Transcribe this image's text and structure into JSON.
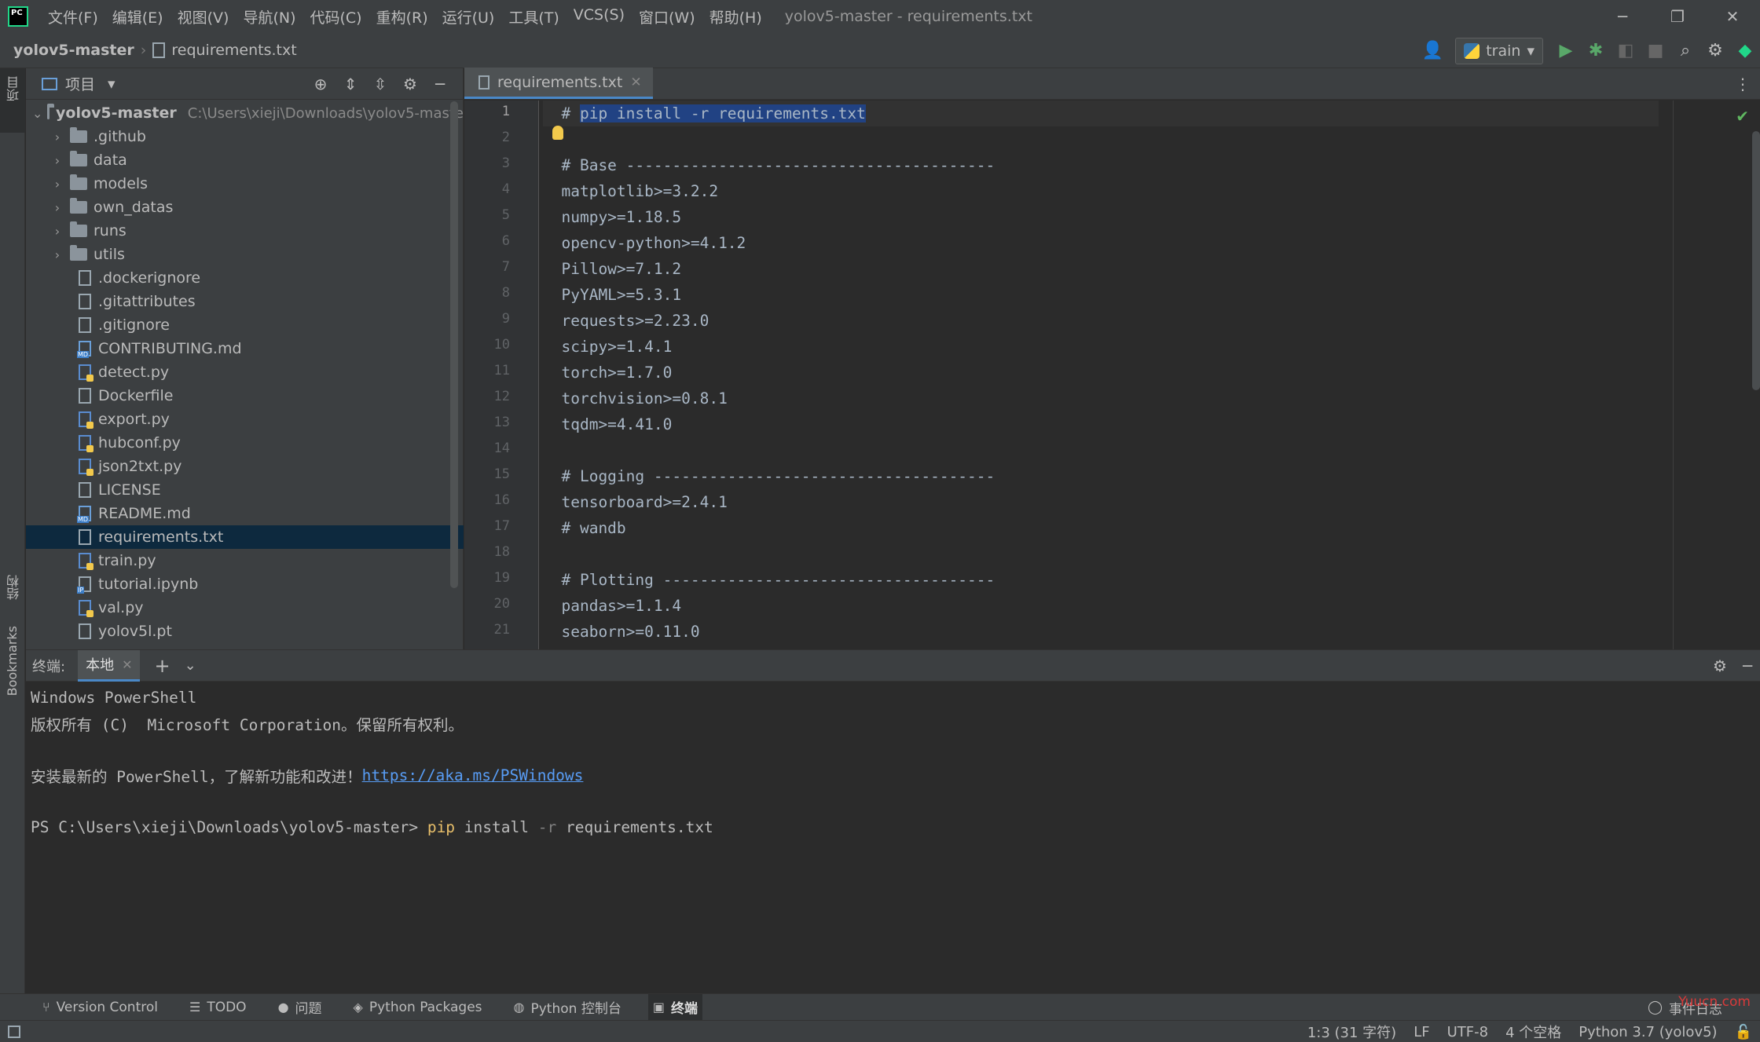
{
  "app": {
    "logo_text": "PC",
    "menu": [
      "文件(F)",
      "编辑(E)",
      "视图(V)",
      "导航(N)",
      "代码(C)",
      "重构(R)",
      "运行(U)",
      "工具(T)",
      "VCS(S)",
      "窗口(W)",
      "帮助(H)"
    ],
    "window_title": "yolov5-master - requirements.txt"
  },
  "breadcrumb": {
    "project": "yolov5-master",
    "file": "requirements.txt"
  },
  "run_config": {
    "label": "train"
  },
  "left_strip": {
    "project": "项目",
    "structure": "结构",
    "bookmarks": "Bookmarks"
  },
  "project_panel": {
    "title": "项目",
    "tree": [
      {
        "name": "yolov5-master",
        "type": "root",
        "hint": "C:\\Users\\xieji\\Downloads\\yolov5-maste"
      },
      {
        "name": ".github",
        "type": "folder"
      },
      {
        "name": "data",
        "type": "folder"
      },
      {
        "name": "models",
        "type": "folder"
      },
      {
        "name": "own_datas",
        "type": "folder"
      },
      {
        "name": "runs",
        "type": "folder"
      },
      {
        "name": "utils",
        "type": "folder"
      },
      {
        "name": ".dockerignore",
        "type": "file"
      },
      {
        "name": ".gitattributes",
        "type": "file"
      },
      {
        "name": ".gitignore",
        "type": "file"
      },
      {
        "name": "CONTRIBUTING.md",
        "type": "md"
      },
      {
        "name": "detect.py",
        "type": "py"
      },
      {
        "name": "Dockerfile",
        "type": "file"
      },
      {
        "name": "export.py",
        "type": "py"
      },
      {
        "name": "hubconf.py",
        "type": "py"
      },
      {
        "name": "json2txt.py",
        "type": "py"
      },
      {
        "name": "LICENSE",
        "type": "file"
      },
      {
        "name": "README.md",
        "type": "md"
      },
      {
        "name": "requirements.txt",
        "type": "file",
        "selected": true
      },
      {
        "name": "train.py",
        "type": "py"
      },
      {
        "name": "tutorial.ipynb",
        "type": "nb"
      },
      {
        "name": "val.py",
        "type": "py"
      },
      {
        "name": "yolov5l.pt",
        "type": "file"
      }
    ]
  },
  "editor": {
    "tab_label": "requirements.txt",
    "lines": [
      "# pip install -r requirements.txt",
      "",
      "# Base ----------------------------------------",
      "matplotlib>=3.2.2",
      "numpy>=1.18.5",
      "opencv-python>=4.1.2",
      "Pillow>=7.1.2",
      "PyYAML>=5.3.1",
      "requests>=2.23.0",
      "scipy>=1.4.1",
      "torch>=1.7.0",
      "torchvision>=0.8.1",
      "tqdm>=4.41.0",
      "",
      "# Logging -------------------------------------",
      "tensorboard>=2.4.1",
      "# wandb",
      "",
      "# Plotting ------------------------------------",
      "pandas>=1.1.4",
      "seaborn>=0.11.0"
    ]
  },
  "terminal": {
    "title": "终端:",
    "tab_label": "本地",
    "line1": "Windows PowerShell",
    "line2": "版权所有 (C)  Microsoft Corporation。保留所有权利。",
    "line3_prefix": "安装最新的 PowerShell，了解新功能和改进！",
    "line3_link": "https://aka.ms/PSWindows",
    "prompt": "PS C:\\Users\\xieji\\Downloads\\yolov5-master> ",
    "cmd": "pip",
    "arg1": " install ",
    "flag": "-r",
    "arg2": " requirements.txt"
  },
  "tool_windows": [
    {
      "label": "Version Control",
      "icon": "branch-icon"
    },
    {
      "label": "TODO",
      "icon": "list-icon"
    },
    {
      "label": "问题",
      "icon": "info-icon"
    },
    {
      "label": "Python Packages",
      "icon": "layers-icon"
    },
    {
      "label": "Python 控制台",
      "icon": "python-icon"
    },
    {
      "label": "终端",
      "icon": "terminal-icon",
      "active": true
    }
  ],
  "event_log": "事件日志",
  "watermark": "Yuucn.com",
  "status": {
    "position": "1:3 (31 字符)",
    "line_sep": "LF",
    "encoding": "UTF-8",
    "indent": "4 个空格",
    "interpreter": "Python 3.7 (yolov5)"
  },
  "colors": {
    "accent": "#4a88c7",
    "selection": "#214283",
    "tree_selected": "#0d293e",
    "link": "#589df6",
    "command": "#e8bf6a"
  }
}
